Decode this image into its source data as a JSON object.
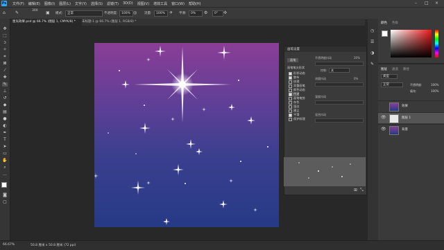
{
  "menubar": {
    "logo": "Ps",
    "items": [
      "文件(F)",
      "编辑(E)",
      "图像(I)",
      "图层(L)",
      "文字(Y)",
      "选择(S)",
      "滤镜(T)",
      "3D(D)",
      "视图(V)",
      "增效工具",
      "窗口(W)",
      "帮助(H)"
    ]
  },
  "options": {
    "size_value": "300",
    "mode_label": "模式:",
    "mode_value": "正常",
    "opacity_label": "不透明度:",
    "opacity_value": "100%",
    "flow_label": "流量:",
    "flow_value": "100%",
    "smooth_label": "平滑:",
    "smooth_value": "0%",
    "angle_value": "0°"
  },
  "tabs": [
    {
      "label": "星光效果.psd @ 66.7% (图层 1, CMYK/8) *",
      "active": true
    },
    {
      "label": "未标题-1 @ 66.7% (图层 1, RGB/8) *",
      "active": false
    }
  ],
  "brush_panel": {
    "title": "画笔设置",
    "brush_tab": "画笔",
    "presets_label": "画笔笔尖形状",
    "options": [
      {
        "label": "形状动态",
        "checked": true
      },
      {
        "label": "散布",
        "checked": true
      },
      {
        "label": "纹理",
        "checked": false
      },
      {
        "label": "双重画笔",
        "checked": false
      },
      {
        "label": "颜色动态",
        "checked": false
      },
      {
        "label": "传递",
        "checked": true,
        "selected": true
      },
      {
        "label": "画笔笔势",
        "checked": false
      },
      {
        "label": "杂色",
        "checked": false
      },
      {
        "label": "湿边",
        "checked": false
      },
      {
        "label": "建立",
        "checked": false
      },
      {
        "label": "平滑",
        "checked": true
      },
      {
        "label": "保护纹理",
        "checked": false
      }
    ],
    "right_labels": {
      "opacity_jitter": "不透明度抖动",
      "opacity_jitter_value": "20%",
      "control": "控制:",
      "control_value": "关",
      "flow_jitter": "流量抖动",
      "flow_jitter_value": "0%",
      "wetness": "湿度抖动",
      "mix": "混合抖动"
    }
  },
  "color_panel": {
    "tab1": "颜色",
    "tab2": "色板"
  },
  "layers_panel": {
    "tabs": [
      "图层",
      "通道",
      "路径"
    ],
    "search_label": "类型",
    "blend_mode": "正常",
    "opacity_label": "不透明度:",
    "opacity_value": "100%",
    "fill_label": "填充:",
    "fill_value": "100%",
    "layers": [
      {
        "name": "效果",
        "selected": false,
        "visible": false
      },
      {
        "name": "图层 1",
        "selected": true,
        "visible": true
      },
      {
        "name": "背景",
        "selected": false,
        "visible": true
      }
    ]
  },
  "status": {
    "zoom": "66.67%",
    "doc_info": "50.8 厘米 x 50.8 厘米 (72 ppi)"
  },
  "colors": {
    "accent": "#31a8ff",
    "panel": "#3a3a3a",
    "canvas_top": "#8a3e96",
    "canvas_bottom": "#263a86"
  }
}
